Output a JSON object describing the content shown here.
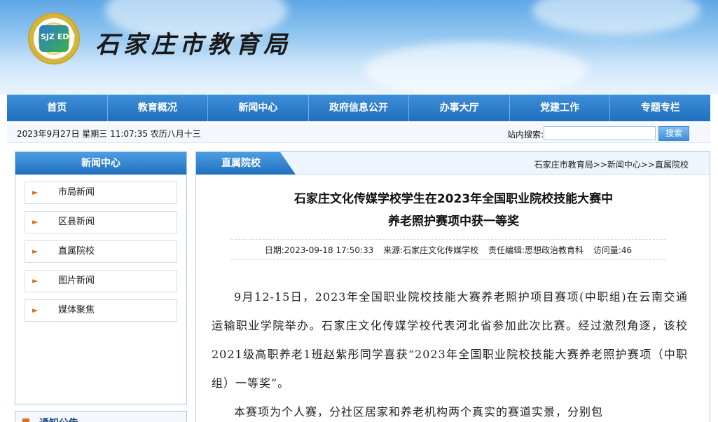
{
  "header": {
    "site_title": "石家庄市教育局",
    "logo_text": "SJZ EDU"
  },
  "nav": [
    "首页",
    "教育概况",
    "新闻中心",
    "政府信息公开",
    "办事大厅",
    "党建工作",
    "专题专栏"
  ],
  "datebar": {
    "date_text": "2023年9月27日 星期三 11:07:35 农历八月十三",
    "search_label": "站内搜索:",
    "search_placeholder": "",
    "search_button": "搜索"
  },
  "sidebar": {
    "title": "新闻中心",
    "items": [
      {
        "label": "市局新闻"
      },
      {
        "label": "区县新闻"
      },
      {
        "label": "直属院校"
      },
      {
        "label": "图片新闻"
      },
      {
        "label": "媒体聚焦"
      }
    ],
    "next_title": "通知公告"
  },
  "main": {
    "tab": "直属院校",
    "breadcrumb": "石家庄市教育局>>新闻中心>>直属院校",
    "title_line1": "石家庄文化传媒学校学生在2023年全国职业院校技能大赛中",
    "title_line2": "养老照护赛项中获一等奖",
    "meta": {
      "date": "日期:2023-09-18 17:50:33",
      "source": "来源:石家庄文化传媒学校",
      "editor": "责任编辑:思想政治教育科",
      "views": "访问量:46"
    },
    "paragraphs": [
      "9月12-15日，2023年全国职业院校技能大赛养老照护项目赛项(中职组)在云南交通运输职业学院举办。石家庄文化传媒学校代表河北省参加此次比赛。经过激烈角逐，该校2021级高职养老1班赵紫彤同学喜获“2023年全国职业院校技能大赛养老照护赛项（中职组）一等奖”。",
      "本赛项为个人赛，分社区居家和养老机构两个真实的赛道实景，分别包"
    ]
  }
}
